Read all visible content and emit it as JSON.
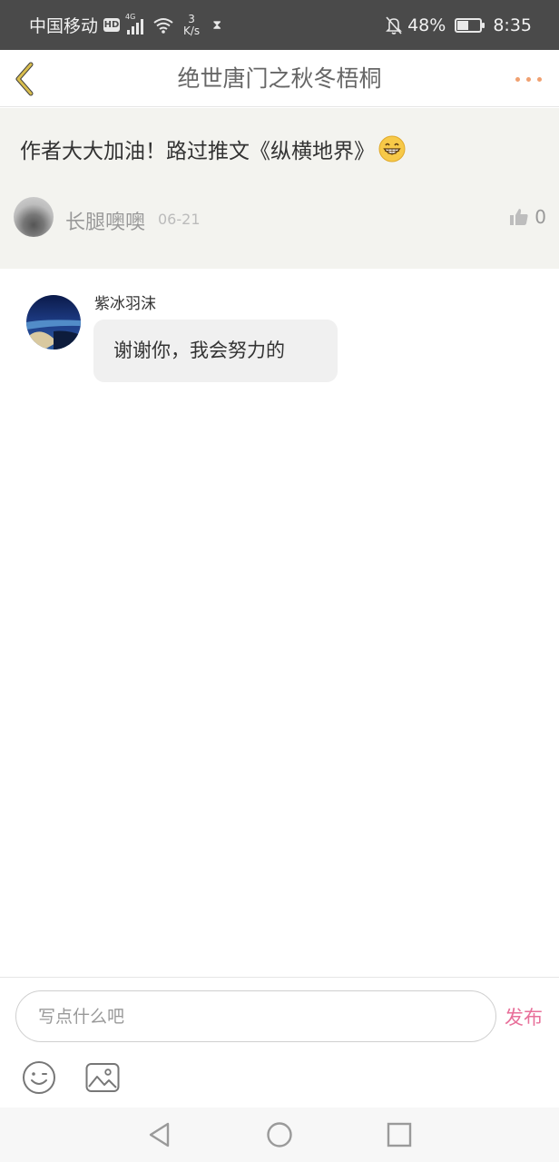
{
  "status_bar": {
    "carrier": "中国移动",
    "hd": "HD",
    "network": "4G",
    "speed_value": "3",
    "speed_unit": "K/s",
    "battery": "48%",
    "battery_level": 0.48,
    "time": "8:35"
  },
  "header": {
    "title": "绝世唐门之秋冬梧桐",
    "back_icon": "chevron-left-icon",
    "more_icon": "more-dots-icon"
  },
  "original_comment": {
    "text": "作者大大加油！路过推文《纵横地界》",
    "emoji": "grinning-face-icon",
    "user_name": "长腿噢噢",
    "date": "06-21",
    "like_count": "0"
  },
  "reply": {
    "user_name": "紫冰羽沫",
    "text": "谢谢你，我会努力的"
  },
  "composer": {
    "placeholder": "写点什么吧",
    "value": "",
    "publish_label": "发布"
  },
  "colors": {
    "accent_publish": "#e8709a",
    "back_arrow": "#d4b340",
    "more_dots": "#f0a070",
    "panel_bg": "#f3f3ef"
  }
}
